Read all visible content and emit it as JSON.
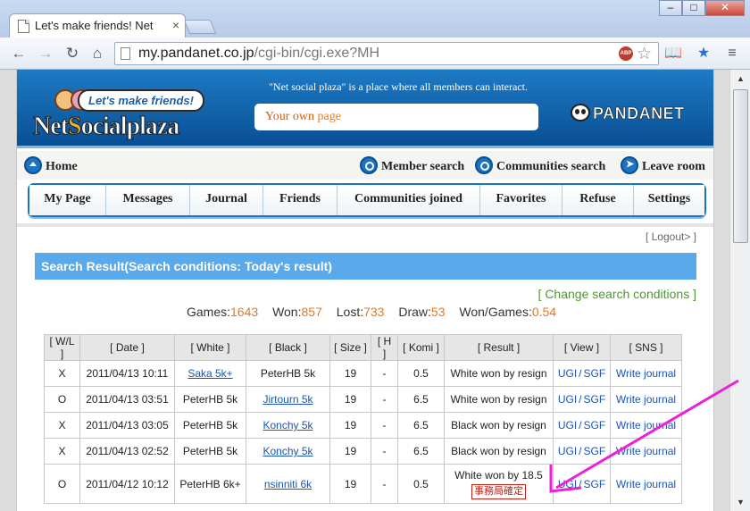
{
  "browser": {
    "tab_title": "Let's make friends! Net",
    "tab_close": "×",
    "window_buttons": [
      "–",
      "□",
      "✕"
    ],
    "url_host": "my.pandanet.co.jp",
    "url_path": "/cgi-bin/cgi.exe?MH",
    "abp_label": "ABP",
    "icons": [
      "back-icon",
      "forward-icon",
      "reload-icon",
      "home-icon",
      "star-icon",
      "reader-icon",
      "translate-icon",
      "menu-icon"
    ]
  },
  "header": {
    "logo_top": "Let's make friends!",
    "logo_main_a": "Net",
    "logo_main_s": "S",
    "logo_main_b": "ocialplaza",
    "tagline": "\"Net social plaza\" is a place where all members can interact.",
    "own_page_a": "Your own",
    "own_page_b": " page",
    "brand": "PANDANET"
  },
  "subnav": {
    "home": "Home",
    "member_search": "Member search",
    "communities_search": "Communities search",
    "leave_room": "Leave room"
  },
  "mainnav": [
    "My Page",
    "Messages",
    "Journal",
    "Friends",
    "Communities joined",
    "Favorites",
    "Refuse",
    "Settings"
  ],
  "logout": "[ Logout> ]",
  "result_title": "Search Result(Search conditions: Today's result)",
  "change_conditions": "[ Change search conditions ]",
  "stats": {
    "games_label": "Games:",
    "games": "1643",
    "won_label": "Won:",
    "won": "857",
    "lost_label": "Lost:",
    "lost": "733",
    "draw_label": "Draw:",
    "draw": "53",
    "ratio_label": "Won/Games:",
    "ratio": "0.54"
  },
  "table": {
    "headers": [
      "[ W/L ]",
      "[ Date ]",
      "[ White ]",
      "[ Black ]",
      "[ Size ]",
      "[ H ]",
      "[ Komi ]",
      "[ Result ]",
      "[ View ]",
      "[ SNS ]"
    ],
    "view_ugi": "UGI",
    "view_sep": "/",
    "view_sgf": "SGF",
    "sns": "Write journal",
    "rows": [
      {
        "wl": "X",
        "date": "2011/04/13 10:11",
        "white": "Saka 5k+",
        "black": "PeterHB 5k",
        "size": "19",
        "h": "-",
        "komi": "0.5",
        "result": "White won by resign"
      },
      {
        "wl": "O",
        "date": "2011/04/13 03:51",
        "white": "PeterHB 5k",
        "black": "Jirtourn 5k",
        "size": "19",
        "h": "-",
        "komi": "6.5",
        "result": "White won by resign"
      },
      {
        "wl": "X",
        "date": "2011/04/13 03:05",
        "white": "PeterHB 5k",
        "black": "Konchy 5k",
        "size": "19",
        "h": "-",
        "komi": "6.5",
        "result": "Black won by resign"
      },
      {
        "wl": "X",
        "date": "2011/04/13 02:52",
        "white": "PeterHB 5k",
        "black": "Konchy 5k",
        "size": "19",
        "h": "-",
        "komi": "6.5",
        "result": "Black won by resign"
      },
      {
        "wl": "O",
        "date": "2011/04/12 10:12",
        "white": "PeterHB 6k+",
        "black": "nsinniti 6k",
        "size": "19",
        "h": "-",
        "komi": "0.5",
        "result": "White won by 18.5",
        "confirm": "事務局確定"
      }
    ]
  },
  "colors": {
    "header_blue": "#1d7bc4",
    "result_bar": "#5aa9ea",
    "accent_orange": "#e87722",
    "green_link": "#4c9a2a",
    "arrow_magenta": "#ee1fd8"
  }
}
